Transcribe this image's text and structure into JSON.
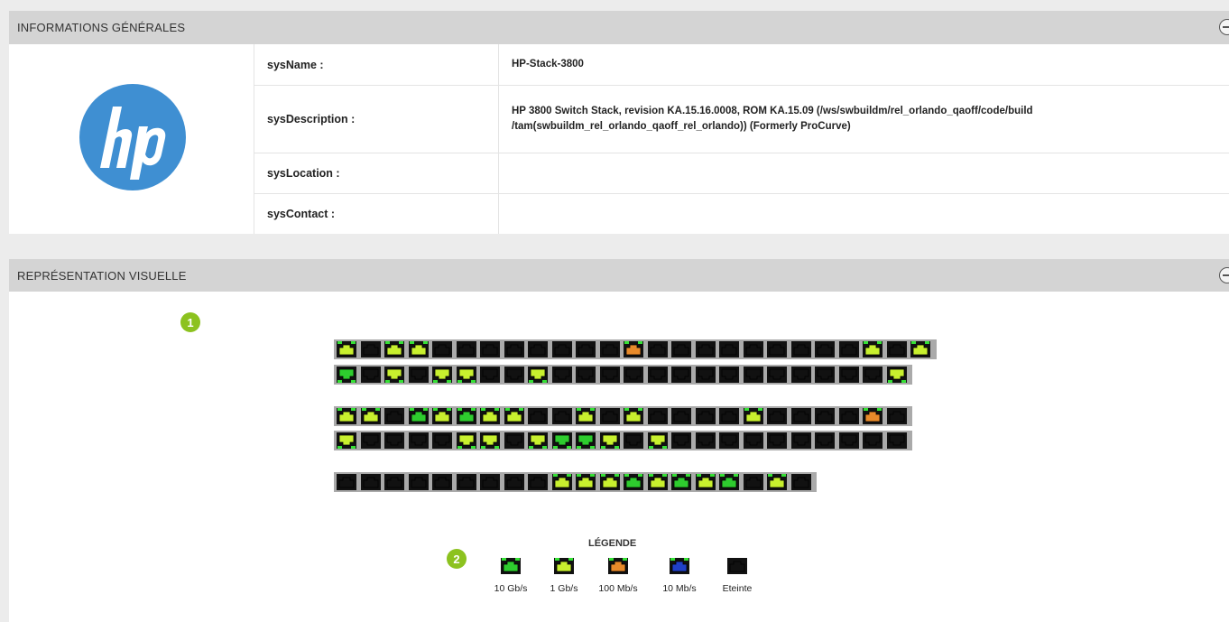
{
  "general": {
    "title": "INFORMATIONS GÉNÉRALES",
    "rows": [
      {
        "label": "sysName :",
        "value": "HP-Stack-3800"
      },
      {
        "label": "sysDescription :",
        "value": "HP 3800 Switch Stack, revision KA.15.16.0008, ROM KA.15.09 (/ws/swbuildm/rel_orlando_qaoff/code/build /tam(swbuildm_rel_orlando_qaoff_rel_orlando)) (Formerly ProCurve)"
      },
      {
        "label": "sysLocation :",
        "value": ""
      },
      {
        "label": "sysContact :",
        "value": ""
      }
    ],
    "logo_icon": "hp-logo",
    "logo_color": "#3f8fd2"
  },
  "visual": {
    "title": "REPRÉSENTATION VISUELLE",
    "marker1": "1",
    "marker2": "2",
    "colors": {
      "10g": "#2ecc2e",
      "1g": "#c8f02e",
      "100m": "#e88a2a",
      "10m": "#2040c8",
      "off": "#111111",
      "link": "#35e035",
      "chassis": "#aaaaaa"
    },
    "switches": [
      {
        "top": [
          "1g",
          "off",
          "1g",
          "1g",
          "off",
          "off",
          "off",
          "off",
          "off",
          "off",
          "off",
          "off",
          "100m",
          "off",
          "off",
          "off",
          "off",
          "off",
          "off",
          "off",
          "off",
          "off",
          "1g",
          "off",
          "1g"
        ],
        "bottom": [
          "10g",
          "off",
          "1g",
          "off",
          "1g",
          "1g",
          "off",
          "off",
          "1g",
          "off",
          "off",
          "off",
          "off",
          "off",
          "off",
          "off",
          "off",
          "off",
          "off",
          "off",
          "off",
          "off",
          "off",
          "1g"
        ]
      },
      {
        "top": [
          "1g",
          "1g",
          "off",
          "10g",
          "1g",
          "10g",
          "1g",
          "1g",
          "off",
          "off",
          "1g",
          "off",
          "1g",
          "off",
          "off",
          "off",
          "off",
          "1g",
          "off",
          "off",
          "off",
          "off",
          "100m",
          "off"
        ],
        "bottom": [
          "1g",
          "off",
          "off",
          "off",
          "off",
          "1g",
          "1g",
          "off",
          "1g",
          "10g",
          "10g",
          "1g",
          "off",
          "1g",
          "off",
          "off",
          "off",
          "off",
          "off",
          "off",
          "off",
          "off",
          "off",
          "off"
        ]
      }
    ],
    "module": [
      "off",
      "off",
      "off",
      "off",
      "off",
      "off",
      "off",
      "off",
      "off",
      "1g",
      "1g",
      "1g",
      "10g",
      "1g",
      "10g",
      "1g",
      "10g",
      "off",
      "1g",
      "off"
    ],
    "legend": {
      "title": "LÉGENDE",
      "items": [
        {
          "key": "10g",
          "label": "10 Gb/s"
        },
        {
          "key": "1g",
          "label": "1 Gb/s"
        },
        {
          "key": "100m",
          "label": "100 Mb/s"
        },
        {
          "key": "10m",
          "label": "10 Mb/s"
        },
        {
          "key": "off",
          "label": "Eteinte"
        }
      ]
    }
  }
}
